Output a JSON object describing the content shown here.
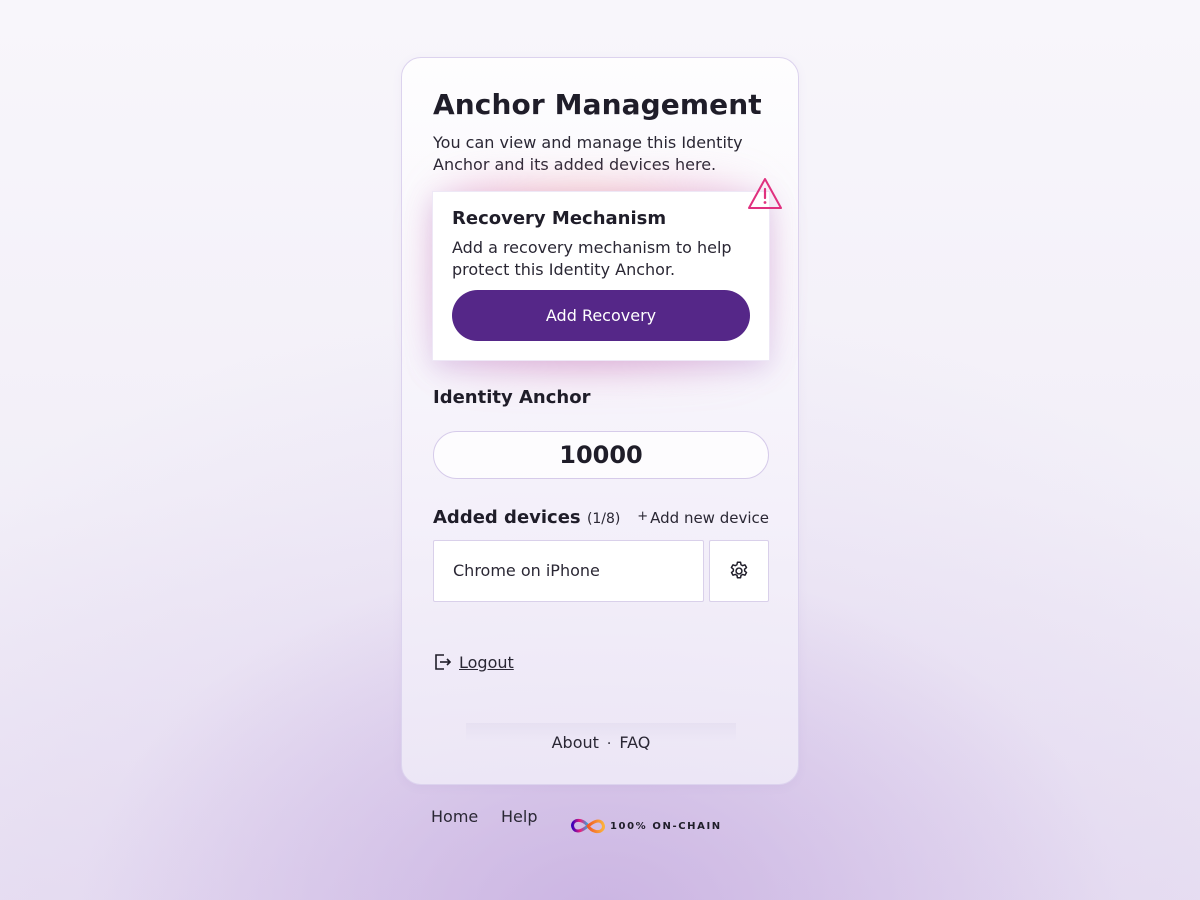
{
  "main": {
    "title": "Anchor Management",
    "description": "You can view and manage this Identity Anchor and its added devices here."
  },
  "recovery": {
    "title": "Recovery Mechanism",
    "description": "Add a recovery mechanism to help protect this Identity Anchor.",
    "button_label": "Add Recovery",
    "icon": "warning-icon",
    "warning_color": "#e0317f",
    "button_color": "#552788"
  },
  "identity_anchor": {
    "label": "Identity Anchor",
    "value": "10000"
  },
  "devices": {
    "title": "Added devices",
    "count": "(1/8)",
    "add_plus": "+",
    "add_label": "Add new device",
    "items": [
      {
        "name": "Chrome on iPhone",
        "settings_icon": "gear-icon"
      }
    ]
  },
  "logout": {
    "label": "Logout",
    "icon": "logout-icon"
  },
  "card_footer": {
    "about": "About",
    "separator": "·",
    "faq": "FAQ"
  },
  "page_footer": {
    "home": "Home",
    "help": "Help",
    "onchain_label": "100% ON-CHAIN",
    "onchain_icon": "infinity-logo-icon"
  }
}
